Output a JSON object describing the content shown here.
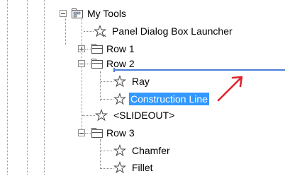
{
  "tree": {
    "my_tools": {
      "label": "My Tools",
      "expanded": true
    },
    "panel_dialog_box_launcher": {
      "label": "Panel Dialog Box Launcher"
    },
    "row1": {
      "label": "Row 1",
      "expanded": false
    },
    "row2": {
      "label": "Row 2",
      "expanded": true,
      "children": [
        {
          "label": "Ray"
        },
        {
          "label": "Construction Line",
          "selected": true
        }
      ]
    },
    "slideout": {
      "label": "<SLIDEOUT>"
    },
    "row3": {
      "label": "Row 3",
      "expanded": true,
      "children": [
        {
          "label": "Chamfer"
        },
        {
          "label": "Fillet"
        }
      ]
    }
  },
  "colors": {
    "selection": "#3399ff",
    "drop_indicator": "#4a7fd8",
    "arrow": "#e0202a"
  },
  "icons": {
    "folder": "tool-palette-folder-icon",
    "star": "command-star-icon",
    "arrow": "red-arrow-annotation"
  }
}
